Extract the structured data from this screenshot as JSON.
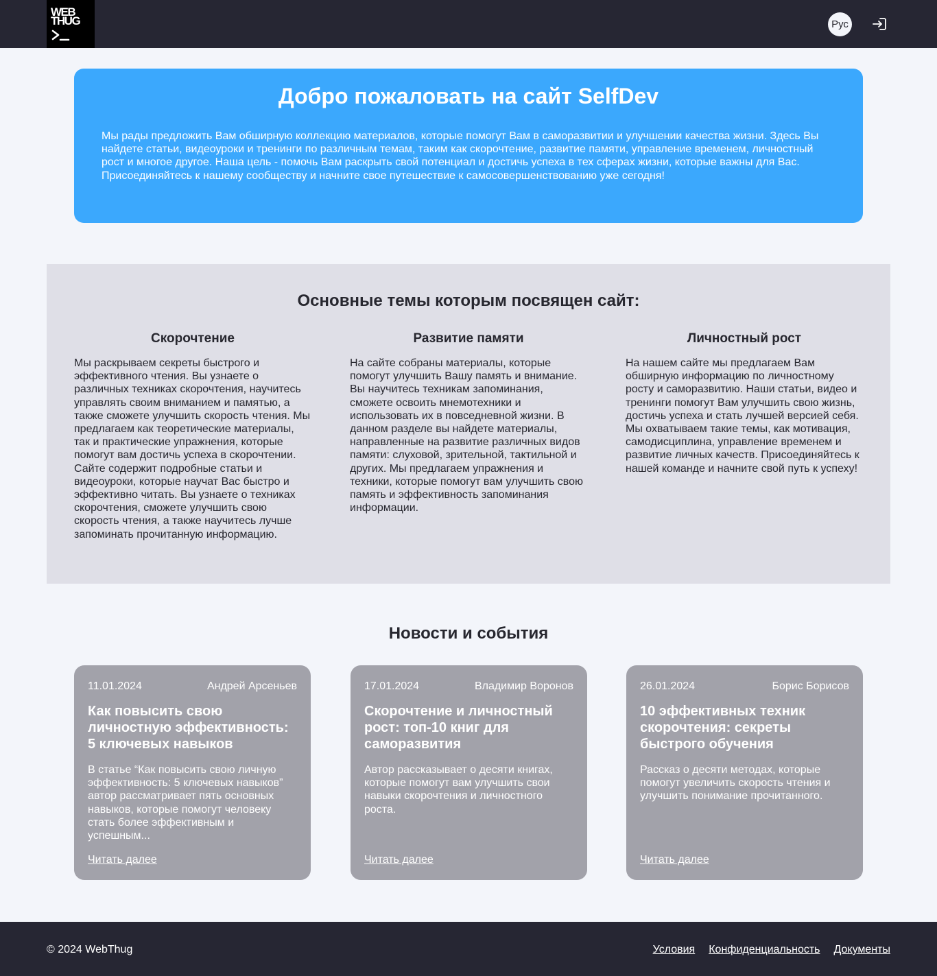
{
  "header": {
    "logo_line1": "WEB",
    "logo_line2": "THUG",
    "lang_label": "Рус",
    "login_icon": "login-icon"
  },
  "hero": {
    "title": "Добро пожаловать на сайт SelfDev",
    "text": "Мы рады предложить Вам обширную коллекцию материалов, которые помогут Вам в саморазвитии и улучшении качества жизни. Здесь Вы найдете статьи, видеоуроки и тренинги по различным темам, таким как скорочтение, развитие памяти, управление временем, личностный рост и многое другое. Наша цель - помочь Вам раскрыть свой потенциал и достичь успеха в тех сферах жизни, которые важны для Вас. Присоединяйтесь к нашему сообществу и начните свое путешествие к самосовершенствованию уже сегодня!"
  },
  "topics": {
    "title": "Основные темы которым посвящен сайт:",
    "items": [
      {
        "title": "Скорочтение",
        "text": "Мы раскрываем секреты быстрого и эффективного чтения. Вы узнаете о различных техниках скорочтения, научитесь управлять своим вниманием и памятью, а также сможете улучшить скорость чтения. Мы предлагаем как теоретические материалы, так и практические упражнения, которые помогут вам достичь успеха в скорочтении. Сайте содержит подробные статьи и видеоуроки, которые научат Вас быстро и эффективно читать. Вы узнаете о техниках скорочтения, сможете улучшить свою скорость чтения, а также научитесь лучше запоминать прочитанную информацию."
      },
      {
        "title": "Развитие памяти",
        "text": "На сайте собраны материалы, которые помогут улучшить Вашу память и внимание. Вы научитесь техникам запоминания, сможете освоить мнемотехники и использовать их в повседневной жизни. В данном разделе вы найдете материалы, направленные на развитие различных видов памяти: слуховой, зрительной, тактильной и других. Мы предлагаем упражнения и техники, которые помогут вам улучшить свою память и эффективность запоминания информации."
      },
      {
        "title": "Личностный рост",
        "text": "На нашем сайте мы предлагаем Вам обширную информацию по личностному росту и саморазвитию. Наши статьи, видео и тренинги помогут Вам улучшить свою жизнь, достичь успеха и стать лучшей версией себя. Мы охватываем такие темы, как мотивация, самодисциплина, управление временем и развитие личных качеств. Присоединяйтесь к нашей команде и начните свой путь к успеху!"
      }
    ]
  },
  "news": {
    "title": "Новости и события",
    "read_more": "Читать далее",
    "items": [
      {
        "date": "11.01.2024",
        "author": "Андрей Арсеньев",
        "title": "Как повысить свою личностную эффективность: 5 ключевых навыков",
        "text": "В статье “Как повысить свою личную эффективность: 5 ключевых навыков” автор рассматривает пять основных навыков, которые помогут человеку стать более эффективным и успешным..."
      },
      {
        "date": "17.01.2024",
        "author": "Владимир Воронов",
        "title": "Скорочтение и личностный рост: топ-10 книг для саморазвития",
        "text": "Автор рассказывает о десяти книгах, которые помогут вам улучшить свои навыки скорочтения и личностного роста."
      },
      {
        "date": "26.01.2024",
        "author": "Борис Борисов",
        "title": "10 эффективных техник скорочтения: секреты быстрого обучения",
        "text": "Рассказ о десяти методах, которые помогут увеличить скорость чтения и улучшить понимание прочитанного."
      }
    ]
  },
  "footer": {
    "copyright": "© 2024 WebThug",
    "links": [
      "Условия",
      "Конфиденциальность",
      "Документы"
    ]
  }
}
